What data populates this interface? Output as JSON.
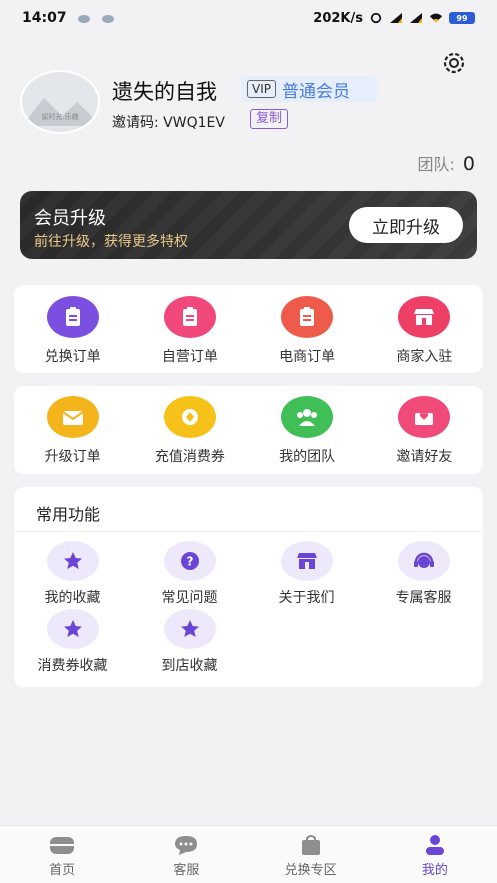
{
  "status_bar": {
    "time": "14:07",
    "speed": "202K/s",
    "battery": "99"
  },
  "profile": {
    "avatar_caption": "留时光.乐趣",
    "username": "遗失的自我",
    "vip_tag": "VIP",
    "member_level": "普通会员",
    "invite_code_label": "邀请码: VWQ1EV",
    "copy_label": "复制",
    "team_label": "团队:",
    "team_count": "0"
  },
  "upgrade_banner": {
    "title": "会员升级",
    "subtitle": "前往升级，获得更多特权",
    "button": "立即升级"
  },
  "orders_row": [
    {
      "label": "兑换订单",
      "color": "#7b4fe0",
      "icon": "clipboard-icon"
    },
    {
      "label": "自营订单",
      "color": "#f0487a",
      "icon": "clipboard-icon"
    },
    {
      "label": "电商订单",
      "color": "#ef5b4a",
      "icon": "clipboard-icon"
    },
    {
      "label": "商家入驻",
      "color": "#ee3f67",
      "icon": "store-icon"
    }
  ],
  "services_row": [
    {
      "label": "升级订单",
      "color": "#f4b41c",
      "icon": "mail-icon"
    },
    {
      "label": "充值消费券",
      "color": "#f6c21a",
      "icon": "coin-icon"
    },
    {
      "label": "我的团队",
      "color": "#3fbf56",
      "icon": "group-icon"
    },
    {
      "label": "邀请好友",
      "color": "#ef4a78",
      "icon": "invite-icon"
    }
  ],
  "common": {
    "title": "常用功能",
    "items": [
      {
        "label": "我的收藏",
        "icon": "star-icon"
      },
      {
        "label": "常见问题",
        "icon": "question-icon"
      },
      {
        "label": "关于我们",
        "icon": "store-icon"
      },
      {
        "label": "专属客服",
        "icon": "headset-icon"
      },
      {
        "label": "消费券收藏",
        "icon": "star-icon"
      },
      {
        "label": "到店收藏",
        "icon": "star-icon"
      }
    ]
  },
  "tabbar": [
    {
      "label": "首页",
      "icon": "home-icon",
      "active": false
    },
    {
      "label": "客服",
      "icon": "chat-icon",
      "active": false
    },
    {
      "label": "兑换专区",
      "icon": "bag-icon",
      "active": false
    },
    {
      "label": "我的",
      "icon": "user-icon",
      "active": true
    }
  ],
  "colors": {
    "accent": "#6a45d6",
    "vip_blue": "#4a7de0",
    "gold": "#e9c98a"
  }
}
